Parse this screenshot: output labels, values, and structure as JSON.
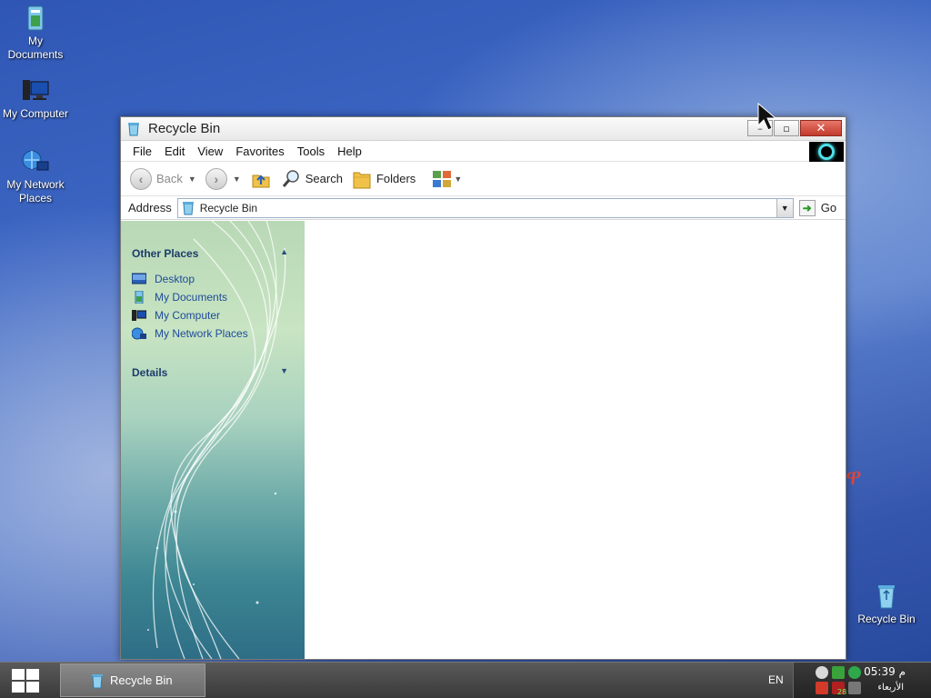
{
  "desktop": {
    "icons": [
      {
        "label": "My Documents"
      },
      {
        "label": "My Computer"
      },
      {
        "label": "My Network Places"
      },
      {
        "label": "Recycle Bin"
      }
    ],
    "stray_glyph": "ዋ"
  },
  "window": {
    "title": "Recycle Bin",
    "controls": {
      "minimize": "–",
      "maximize": "▫",
      "close": "✕"
    }
  },
  "menubar": {
    "items": [
      "File",
      "Edit",
      "View",
      "Favorites",
      "Tools",
      "Help"
    ]
  },
  "toolbar": {
    "back_label": "Back",
    "search_label": "Search",
    "folders_label": "Folders"
  },
  "addressbar": {
    "label": "Address",
    "value": "Recycle Bin",
    "go_label": "Go"
  },
  "sidepane": {
    "other_places": {
      "heading": "Other Places",
      "links": [
        "Desktop",
        "My Documents",
        "My Computer",
        "My Network Places"
      ]
    },
    "details": {
      "heading": "Details"
    }
  },
  "taskbar": {
    "task_label": "Recycle Bin",
    "language": "EN",
    "clock_time": "05:39 م",
    "clock_day": "الأربعاء",
    "tray_badge": "28"
  },
  "colors": {
    "link": "#1e4b9a",
    "heading": "#1d3c6a",
    "close_button": "#c23a2b"
  }
}
